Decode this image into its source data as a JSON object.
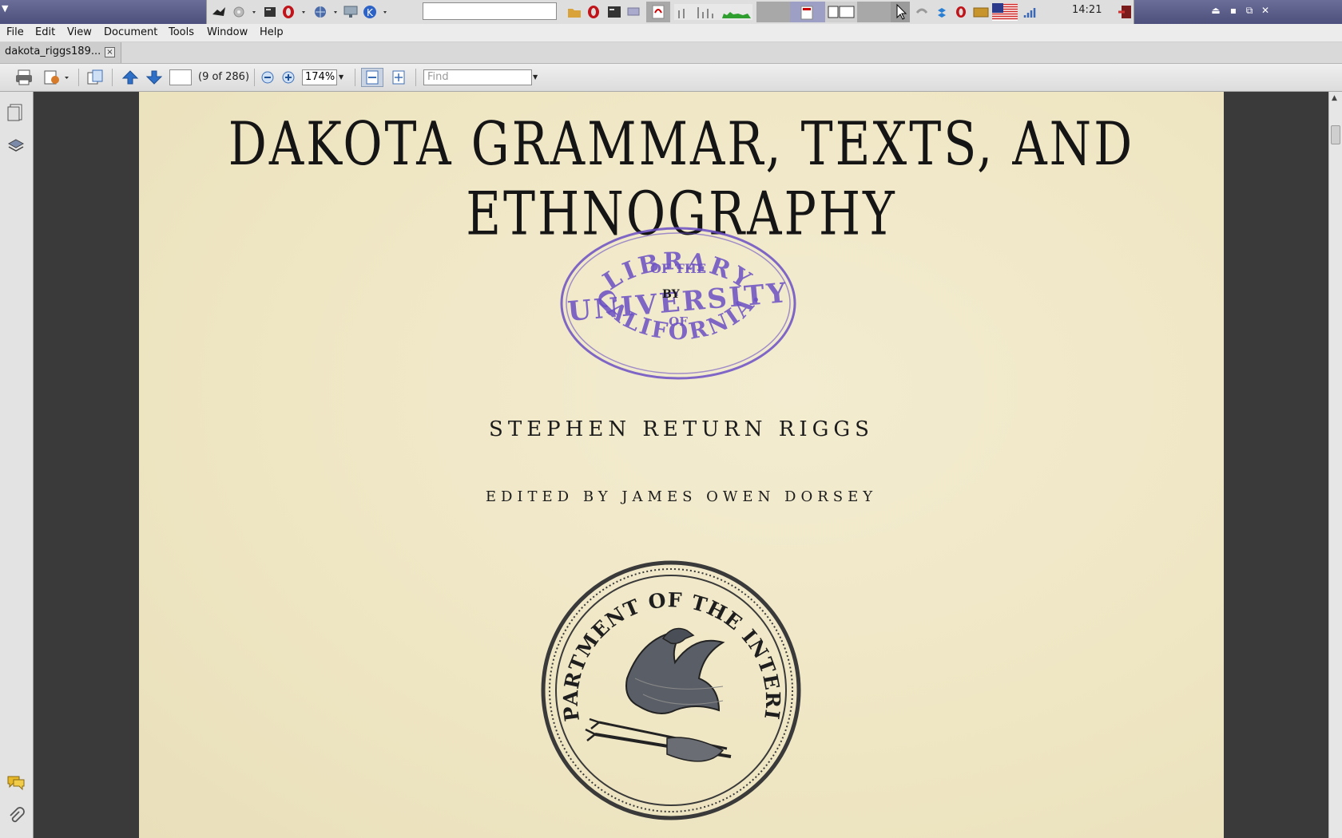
{
  "system_panel": {
    "clock": "14:21"
  },
  "menubar": {
    "items": [
      "File",
      "Edit",
      "View",
      "Document",
      "Tools",
      "Window",
      "Help"
    ]
  },
  "tab": {
    "label": "dakota_riggs189...",
    "close": "×"
  },
  "toolbar": {
    "page_number_value": "",
    "page_count": "(9 of 286)",
    "zoom": "174%",
    "find_placeholder": "Find"
  },
  "document": {
    "title": "DAKOTA GRAMMAR, TEXTS, AND ETHNOGRAPHY",
    "stamp": {
      "line1": "LIBRARY",
      "line2": "OF THE",
      "line3": "UNIVERSITY",
      "line4": "OF",
      "line5": "CALIFORNIA.",
      "color": "#6b4fc4"
    },
    "by": "BY",
    "author": "STEPHEN RETURN RIGGS",
    "editor": "EDITED BY JAMES OWEN DORSEY",
    "seal_text": "DEPARTMENT OF THE INTERIOR"
  },
  "colors": {
    "panel": "#5c5e8c",
    "page_paper": "#efe6c4",
    "viewer_bg": "#3a3a3a"
  }
}
